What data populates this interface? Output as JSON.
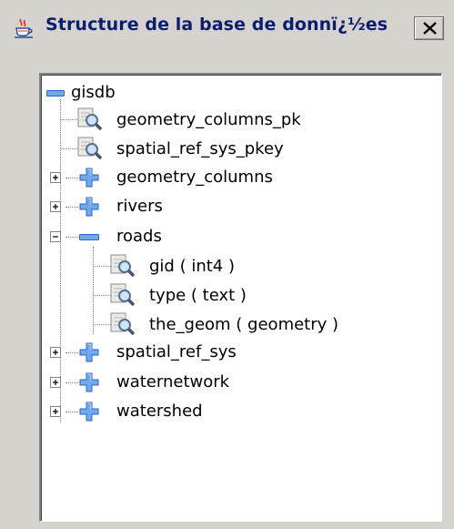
{
  "window": {
    "title": "Structure de la base de donnï¿½es",
    "icon": "java-cup-icon",
    "close_icon": "close-icon"
  },
  "tree": {
    "root": {
      "label": "gisdb",
      "icon": "collapse-minus-icon",
      "expanded": true
    },
    "items": [
      {
        "label": "geometry_columns_pk",
        "icon": "index-magnifier-icon"
      },
      {
        "label": "spatial_ref_sys_pkey",
        "icon": "index-magnifier-icon"
      },
      {
        "label": "geometry_columns",
        "icon": "table-plus-icon",
        "expanded": false
      },
      {
        "label": "rivers",
        "icon": "table-plus-icon",
        "expanded": false
      },
      {
        "label": "roads",
        "icon": "table-minus-icon",
        "expanded": true,
        "children": [
          {
            "label": "gid ( int4 )",
            "icon": "column-magnifier-icon"
          },
          {
            "label": "type ( text )",
            "icon": "column-magnifier-icon"
          },
          {
            "label": "the_geom ( geometry )",
            "icon": "column-magnifier-icon"
          }
        ]
      },
      {
        "label": "spatial_ref_sys",
        "icon": "table-plus-icon",
        "expanded": false
      },
      {
        "label": "waternetwork",
        "icon": "table-plus-icon",
        "expanded": false
      },
      {
        "label": "watershed",
        "icon": "table-plus-icon",
        "expanded": false
      }
    ]
  },
  "colors": {
    "title_text": "#0a1e6e",
    "node_blue": "#3f7fd6",
    "window_bg": "#d6d3ce"
  }
}
